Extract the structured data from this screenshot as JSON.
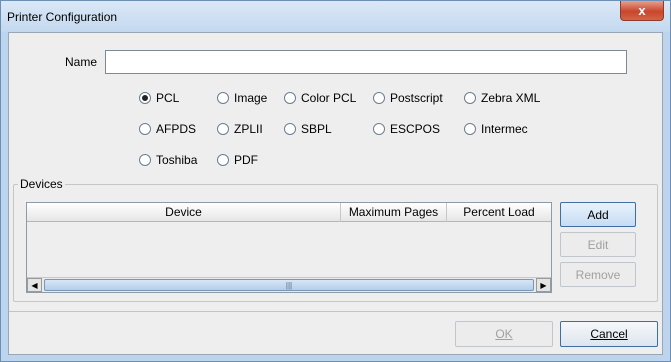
{
  "window": {
    "title": "Printer Configuration",
    "close_glyph": "x"
  },
  "name_field": {
    "label": "Name",
    "value": "",
    "placeholder": ""
  },
  "formats": [
    {
      "label": "PCL",
      "checked": true
    },
    {
      "label": "Image",
      "checked": false
    },
    {
      "label": "Color PCL",
      "checked": false
    },
    {
      "label": "Postscript",
      "checked": false
    },
    {
      "label": "Zebra XML",
      "checked": false
    },
    {
      "label": "AFPDS",
      "checked": false
    },
    {
      "label": "ZPLII",
      "checked": false
    },
    {
      "label": "SBPL",
      "checked": false
    },
    {
      "label": "ESCPOS",
      "checked": false
    },
    {
      "label": "Intermec",
      "checked": false
    },
    {
      "label": "Toshiba",
      "checked": false
    },
    {
      "label": "PDF",
      "checked": false
    }
  ],
  "devices": {
    "group_label": "Devices",
    "columns": [
      "Device",
      "Maximum Pages",
      "Percent Load"
    ],
    "rows": [],
    "scroll_left": "◀",
    "scroll_right": "▶",
    "thumb_grip": "|||"
  },
  "side_buttons": {
    "add": "Add",
    "edit": "Edit",
    "remove": "Remove"
  },
  "footer": {
    "ok_label": "OK",
    "cancel_label": "Cancel"
  }
}
